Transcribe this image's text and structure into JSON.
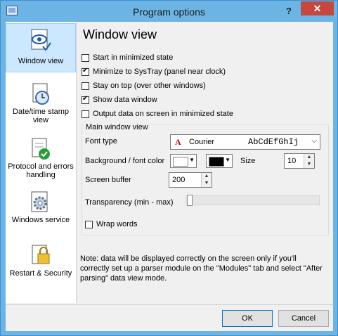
{
  "window": {
    "title": "Program options",
    "help": "?",
    "close": "✕"
  },
  "sidebar": {
    "items": [
      {
        "label": "Window view"
      },
      {
        "label": "Date/time stamp view"
      },
      {
        "label": "Protocol and errors handling"
      },
      {
        "label": "Windows service"
      },
      {
        "label": "Restart & Security"
      }
    ]
  },
  "main": {
    "title": "Window view",
    "checkboxes": [
      {
        "label": "Start in minimized state",
        "checked": false
      },
      {
        "label": "Minimize to SysTray (panel near clock)",
        "checked": true
      },
      {
        "label": "Stay on top (over other windows)",
        "checked": false
      },
      {
        "label": "Show data window",
        "checked": true
      },
      {
        "label": "Output data on screen in minimized state",
        "checked": false
      }
    ],
    "group": {
      "label": "Main window view",
      "font_type_label": "Font type",
      "font_name": "Courier",
      "font_sample": "AbCdEfGhIj",
      "bg_font_label": "Background / font color",
      "size_label": "Size",
      "size_value": "10",
      "buffer_label": "Screen buffer",
      "buffer_value": "200",
      "transparency_label": "Transparency (min - max)",
      "transparency_value": 0,
      "wrap_label": "Wrap words",
      "wrap_checked": false
    },
    "note": "Note: data will be displayed correctly on the screen only if you'll correctly set up a parser module on the \"Modules\" tab and select \"After parsing\" data view mode."
  },
  "footer": {
    "ok": "OK",
    "cancel": "Cancel"
  },
  "colors": {
    "titlebar": "#6cb4e4",
    "close": "#c7463d",
    "active_item": "#cce8ff"
  }
}
